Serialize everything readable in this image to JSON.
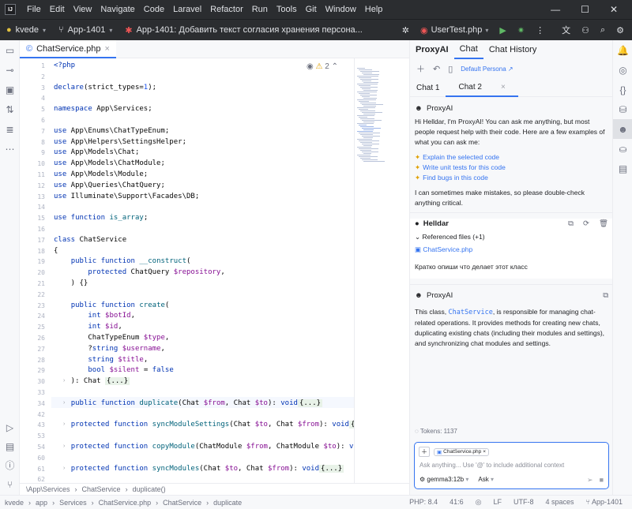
{
  "titlebar": {
    "logo": "IJ",
    "menu": [
      "File",
      "Edit",
      "View",
      "Navigate",
      "Code",
      "Laravel",
      "Refactor",
      "Run",
      "Tools",
      "Git",
      "Window",
      "Help"
    ]
  },
  "toolbar": {
    "project": "kvede",
    "branch": "App-1401",
    "task": "App-1401: Добавить текст согласия хранения персона...",
    "run_config": "UserTest.php"
  },
  "editor": {
    "tab_label": "ChatService.php",
    "inspection_count": "2",
    "lines": [
      {
        "n": "1",
        "html": "<span class='kw'>&lt;?php</span>"
      },
      {
        "n": "2",
        "html": ""
      },
      {
        "n": "3",
        "html": "<span class='kw'>declare</span>(strict_types=<span class='num'>1</span>);"
      },
      {
        "n": "4",
        "html": ""
      },
      {
        "n": "5",
        "html": "<span class='kw'>namespace</span> App\\Services;"
      },
      {
        "n": "6",
        "html": ""
      },
      {
        "n": "7",
        "html": "<span class='kw'>use</span> App\\Enums\\ChatTypeEnum;"
      },
      {
        "n": "8",
        "html": "<span class='kw'>use</span> App\\Helpers\\SettingsHelper;"
      },
      {
        "n": "9",
        "html": "<span class='kw'>use</span> App\\Models\\Chat;"
      },
      {
        "n": "10",
        "html": "<span class='kw'>use</span> App\\Models\\ChatModule;"
      },
      {
        "n": "11",
        "html": "<span class='kw'>use</span> App\\Models\\Module;"
      },
      {
        "n": "12",
        "html": "<span class='kw'>use</span> App\\Queries\\ChatQuery;"
      },
      {
        "n": "13",
        "html": "<span class='kw'>use</span> Illuminate\\Support\\Facades\\DB;"
      },
      {
        "n": "14",
        "html": ""
      },
      {
        "n": "15",
        "html": "<span class='kw'>use function</span> <span class='fn'>is_array</span>;"
      },
      {
        "n": "16",
        "html": ""
      },
      {
        "n": "17",
        "html": "<span class='kw'>class</span> ChatService"
      },
      {
        "n": "18",
        "html": "{"
      },
      {
        "n": "19",
        "html": "    <span class='kw'>public function</span> <span class='fn'>__construct</span>("
      },
      {
        "n": "20",
        "html": "        <span class='kw'>protected</span> ChatQuery <span class='var'>$repository</span>,"
      },
      {
        "n": "21",
        "html": "    ) {}"
      },
      {
        "n": "22",
        "html": ""
      },
      {
        "n": "23",
        "html": "    <span class='kw'>public function</span> <span class='fn'>create</span>("
      },
      {
        "n": "24",
        "html": "        <span class='kw'>int</span> <span class='var'>$botId</span>,"
      },
      {
        "n": "25",
        "html": "        <span class='kw'>int</span> <span class='var'>$id</span>,"
      },
      {
        "n": "26",
        "html": "        ChatTypeEnum <span class='var'>$type</span>,"
      },
      {
        "n": "27",
        "html": "        ?<span class='kw'>string</span> <span class='var'>$username</span>,"
      },
      {
        "n": "28",
        "html": "        <span class='kw'>string</span> <span class='var'>$title</span>,"
      },
      {
        "n": "29",
        "html": "        <span class='kw'>bool</span> <span class='var'>$silent</span> = <span class='kw'>false</span>"
      },
      {
        "n": "30",
        "html": "    ): Chat <span class='fold-chip'>{...}</span>"
      },
      {
        "n": "33",
        "html": ""
      },
      {
        "n": "34",
        "html": "    <span class='kw'>public function</span> <span class='fn'>duplicate</span>(Chat <span class='var'>$from</span>, Chat <span class='var'>$to</span>): <span class='kw'>void</span><span class='fold-chip'>{...}</span>"
      },
      {
        "n": "42",
        "html": ""
      },
      {
        "n": "43",
        "html": "    <span class='kw'>protected function</span> <span class='fn'>syncModuleSettings</span>(Chat <span class='var'>$to</span>, Chat <span class='var'>$from</span>): <span class='kw'>void</span><span class='fold-chip'>{...}</span>"
      },
      {
        "n": "53",
        "html": ""
      },
      {
        "n": "54",
        "html": "    <span class='kw'>protected function</span> <span class='fn'>copyModule</span>(ChatModule <span class='var'>$from</span>, ChatModule <span class='var'>$to</span>): <span class='kw'>void</span><span class='fold-chip'>{...</span>"
      },
      {
        "n": "60",
        "html": ""
      },
      {
        "n": "61",
        "html": "    <span class='kw'>protected function</span> <span class='fn'>syncModules</span>(Chat <span class='var'>$to</span>, Chat <span class='var'>$from</span>): <span class='kw'>void</span><span class='fold-chip'>{...}</span>"
      },
      {
        "n": "62",
        "html": ""
      }
    ],
    "breadcrumb": [
      "\\App\\Services",
      "ChatService",
      "duplicate()"
    ]
  },
  "panel": {
    "tabs": [
      "ProxyAI",
      "Chat",
      "Chat History"
    ],
    "persona": "Default Persona ↗",
    "chat_tabs": [
      "Chat 1",
      "Chat 2"
    ],
    "assistant_name": "ProxyAI",
    "greeting": "Hi Helldar, I'm ProxyAI! You can ask me anything, but most people request help with their code. Here are a few examples of what you can ask me:",
    "suggestions": [
      "Explain the selected code",
      "Write unit tests for this code",
      "Find bugs in this code"
    ],
    "disclaimer": "I can sometimes make mistakes, so please double-check anything critical.",
    "user_name": "Helldar",
    "referenced": "Referenced files (+1)",
    "ref_file": "ChatService.php",
    "user_message": "Кратко опиши что делает этот класс",
    "answer_pre": "This class, ",
    "answer_code": "ChatService",
    "answer_post": ", is responsible for managing chat-related operations. It provides methods for creating new chats, duplicating existing chats (including their modules and settings), and synchronizing chat modules and settings.",
    "tokens": "Tokens: 1137",
    "attached": "ChatService.php",
    "input_placeholder": "Ask anything... Use '@' to include additional context",
    "model": "gemma3:12b",
    "mode": "Ask"
  },
  "status": {
    "crumbs": [
      "kvede",
      "app",
      "Services",
      "ChatService.php",
      "ChatService",
      "duplicate"
    ],
    "php": "PHP: 8.4",
    "pos": "41:6",
    "eol": "LF",
    "enc": "UTF-8",
    "indent": "4 spaces",
    "branch": "App-1401"
  },
  "colors": {
    "accent": "#3574f0",
    "dark": "#2b2d30"
  }
}
